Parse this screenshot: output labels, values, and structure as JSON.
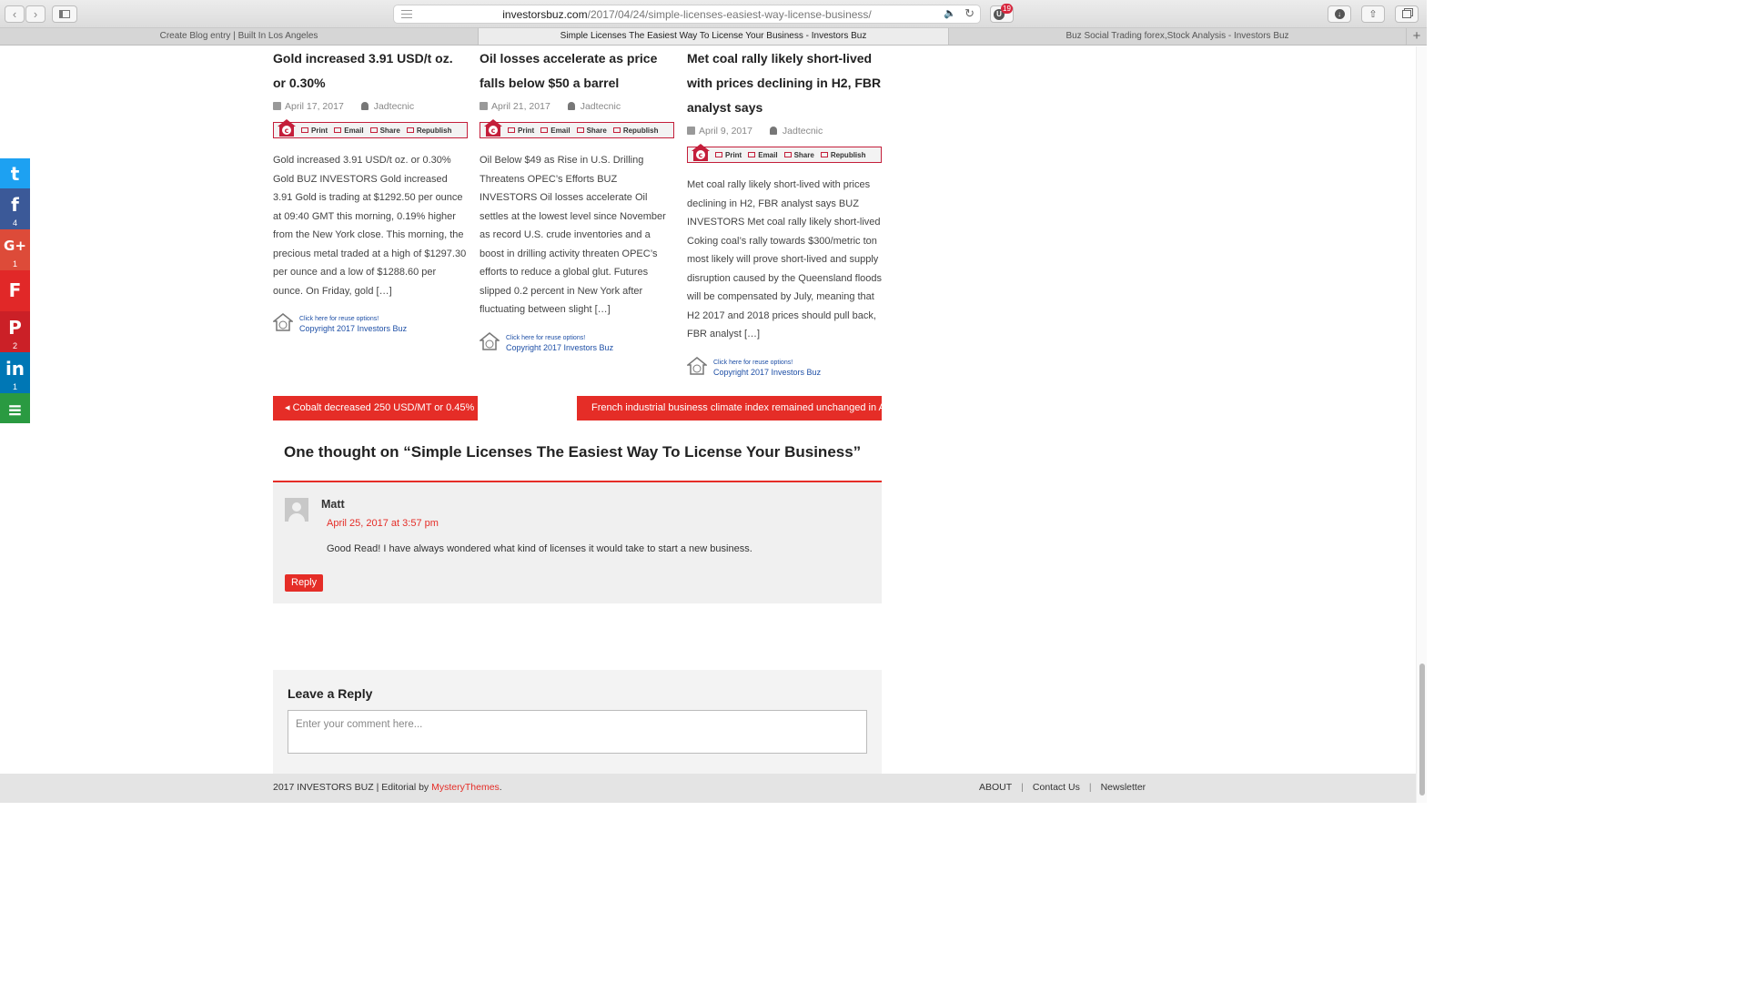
{
  "browser": {
    "url_host": "investorsbuz.com",
    "url_path": "/2017/04/24/simple-licenses-easiest-way-license-business/",
    "extension_badge": "19",
    "extension_letter": "U",
    "tabs": [
      {
        "label": "Create Blog entry | Built In Los Angeles"
      },
      {
        "label": "Simple Licenses The Easiest Way To License Your Business - Investors Buz"
      },
      {
        "label": "Buz Social Trading forex,Stock Analysis - Investors Buz"
      }
    ]
  },
  "social": {
    "twitter": {
      "icon": "twitter-icon",
      "glyph": "t",
      "count": ""
    },
    "facebook": {
      "icon": "facebook-icon",
      "glyph": "f",
      "count": "4"
    },
    "google_plus": {
      "icon": "google-plus-icon",
      "glyph": "G+",
      "count": "1"
    },
    "flipboard": {
      "icon": "flipboard-icon",
      "glyph": "F",
      "count": ""
    },
    "pinterest": {
      "icon": "pinterest-icon",
      "glyph": "P",
      "count": "2"
    },
    "linkedin": {
      "icon": "linkedin-icon",
      "glyph": "in",
      "count": "1"
    },
    "more": {
      "icon": "more-share-icon",
      "glyph": "≡",
      "count": ""
    }
  },
  "related": [
    {
      "title": "Gold increased 3.91 USD/t oz. or 0.30%",
      "date": "April 17, 2017",
      "author": "Jadtecnic",
      "excerpt": "Gold increased 3.91 USD/t oz. or 0.30% Gold BUZ INVESTORS  Gold increased 3.91  Gold is trading at $1292.50 per ounce at 09:40 GMT this morning, 0.19% higher from the New York close. This morning, the precious metal traded at a high of $1297.30 per ounce and a low of $1288.60 per ounce. On Friday, gold […]"
    },
    {
      "title": "Oil losses accelerate as price falls below $50 a barrel",
      "date": "April 21, 2017",
      "author": "Jadtecnic",
      "excerpt": "Oil Below $49 as Rise in U.S. Drilling Threatens OPEC’s Efforts BUZ INVESTORS  Oil losses accelerate   Oil settles at the lowest level since November as record U.S. crude inventories and a boost in drilling activity threaten OPEC’s efforts to reduce a global glut. Futures slipped 0.2 percent in New York after fluctuating between slight […]"
    },
    {
      "title": "Met coal rally likely short-lived with prices declining in H2, FBR analyst says",
      "date": "April 9, 2017",
      "author": "Jadtecnic",
      "excerpt": "Met coal rally likely short-lived with prices declining in H2, FBR analyst says BUZ INVESTORS Met coal rally likely short-lived Coking coal’s rally towards $300/metric ton most likely will prove short-lived and supply disruption caused by the Queensland floods will be compensated by July, meaning that H2 2017 and 2018 prices should pull back, FBR analyst […]"
    }
  ],
  "republish_bar": {
    "print": "Print",
    "email": "Email",
    "share": "Share",
    "republish": "Republish"
  },
  "reuse": {
    "line1": "Click here for reuse options!",
    "line2": "Copyright 2017 Investors Buz"
  },
  "post_nav": {
    "prev": "Cobalt decreased 250 USD/MT or 0.45%",
    "next": "French industrial business climate index remained unchanged in April"
  },
  "comments": {
    "title": "One thought on “Simple Licenses The Easiest Way To License Your Business”",
    "items": [
      {
        "author": "Matt",
        "date": "April 25, 2017 at 3:57 pm",
        "text": "Good Read! I have always wondered what kind of licenses it would take to start a new business.",
        "reply": "Reply"
      }
    ]
  },
  "leave_reply": {
    "title": "Leave a Reply",
    "placeholder": "Enter your comment here..."
  },
  "footer": {
    "copyright": "2017 INVESTORS BUZ | Editorial by ",
    "theme_link": "MysteryThemes",
    "links": [
      "ABOUT",
      "Contact Us",
      "Newsletter"
    ]
  },
  "colors": {
    "accent": "#e52d27",
    "twitter": "#1da1f2",
    "facebook": "#3b5998",
    "google_plus": "#dd4b39",
    "linkedin": "#0077b5",
    "more": "#2a9a41"
  }
}
